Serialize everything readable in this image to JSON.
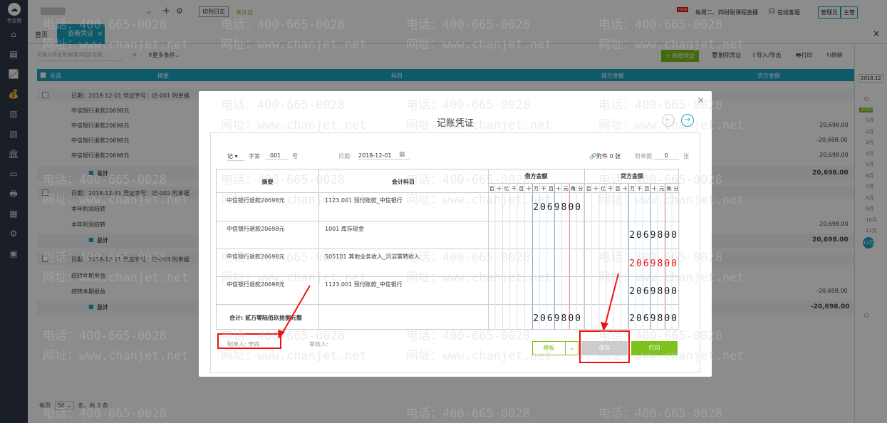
{
  "app": {
    "logo_label": "专业版"
  },
  "sidebar": {
    "icons": [
      "home-icon",
      "voucher-icon",
      "report-icon",
      "money-bag-icon",
      "ledger-icon",
      "image-icon",
      "bank-icon",
      "monitor-icon",
      "print-icon",
      "document-icon",
      "settings-icon",
      "calendar-icon"
    ]
  },
  "topbar": {
    "account_name": "▒▒▒▒▒",
    "switch_log": "切到日志",
    "status": "未认证",
    "notice_badge": "new",
    "notice": "每周二、四财税课程直播",
    "online_service": "在线客服",
    "admin": "管理员",
    "supervisor": "主管"
  },
  "tabs": {
    "home": "首页",
    "active": "查看凭证",
    "active_close": "×"
  },
  "window_close": "×",
  "toolbar": {
    "search_placeholder": "可输入凭证号/摘要/科目/金额...",
    "more_conditions": "更多条件",
    "new_voucher": "+ 新增凭证",
    "delete_voucher": "删除凭证",
    "import_export": "导入/导出",
    "print": "打印",
    "refresh": "刷新"
  },
  "table": {
    "select_all": "全选",
    "cols": [
      "摘要",
      "科目",
      "借方金额",
      "贷方金额"
    ],
    "groups": [
      {
        "head": "日期：2018-12-01    凭证字号：记-001    附单据",
        "lines": [
          {
            "text": "中信银行退款20698元",
            "debit": "",
            "credit": ""
          },
          {
            "text": "中信银行退款20698元",
            "debit": "",
            "credit": "20,698.00"
          },
          {
            "text": "中信银行退款20698元",
            "debit": "",
            "credit": "-20,698.00"
          },
          {
            "text": "中信银行退款20698元",
            "debit": "",
            "credit": "20,698.00"
          }
        ],
        "total_label": "总计",
        "total": "20,698.00"
      },
      {
        "head": "日期：2018-12-31    凭证字号：记-002    附单据",
        "lines": [
          {
            "text": "本年利润结转",
            "debit": "",
            "credit": ""
          },
          {
            "text": "本年利润结转",
            "debit": "",
            "credit": "20,698.00"
          }
        ],
        "total_label": "总计",
        "total": "20,698.00"
      },
      {
        "head": "日期：2018-12-31    凭证字号：记-003    附单据",
        "lines": [
          {
            "text": "结转本期损益",
            "debit": "",
            "credit": ""
          },
          {
            "text": "结转本期损益",
            "debit": "",
            "credit": "-20,698.00"
          }
        ],
        "total_label": "总计",
        "total": "-20,698.00"
      }
    ]
  },
  "pager": {
    "per_page_label": "每页",
    "per_page": "50",
    "total": "条，共 3 条"
  },
  "calendar": {
    "current": "2018.12",
    "year": "2018",
    "months": [
      "1月",
      "2月",
      "3月",
      "4月",
      "5月",
      "6月",
      "7月",
      "8月",
      "9月",
      "10月",
      "11月",
      "12月"
    ]
  },
  "dialog": {
    "title": "记账凭证",
    "close": "×",
    "voucher_type": "记",
    "number_label": "字第",
    "number": "001",
    "number_suffix": "号",
    "date_label": "日期:",
    "date": "2018-12-01",
    "attachment": "附件 0 张",
    "attached_docs_label": "附单据",
    "attached_docs": "0",
    "attached_docs_unit": "张",
    "col_summary": "摘要",
    "col_account": "会计科目",
    "col_debit": "借方金额",
    "col_credit": "贷方金额",
    "digit_units": [
      "百",
      "十",
      "亿",
      "千",
      "百",
      "十",
      "万",
      "千",
      "百",
      "十",
      "元",
      "角",
      "分"
    ],
    "rows": [
      {
        "summary": "中信银行退款20698元",
        "account": "1123.001 预付账款_中信银行",
        "debit": "2069800",
        "credit": "",
        "red": false
      },
      {
        "summary": "中信银行退款20698元",
        "account": "1001 库存现金",
        "debit": "",
        "credit": "2069800",
        "red": false
      },
      {
        "summary": "中信银行退款20698元",
        "account": "505101 其他业务收入_沉淀票转收入",
        "debit": "",
        "credit": "2069800",
        "red": true
      },
      {
        "summary": "中信银行退款20698元",
        "account": "1123.001 预付账款_中信银行",
        "debit": "",
        "credit": "2069800",
        "red": false
      }
    ],
    "total_label": "合计:  贰万零陆佰玖拾捌元整",
    "total_debit": "2069800",
    "total_credit": "2069800",
    "maker": "制单人: 李四",
    "reviewer": "审核人:",
    "template_btn": "模板",
    "save_btn": "保存",
    "print_btn": "打印"
  },
  "watermarks": [
    "电话：400-665-0028",
    "网址：www.chanjet.net"
  ],
  "colors": {
    "accent": "#1aa5c4",
    "green": "#7cc21c",
    "highlight": "#e11111"
  }
}
